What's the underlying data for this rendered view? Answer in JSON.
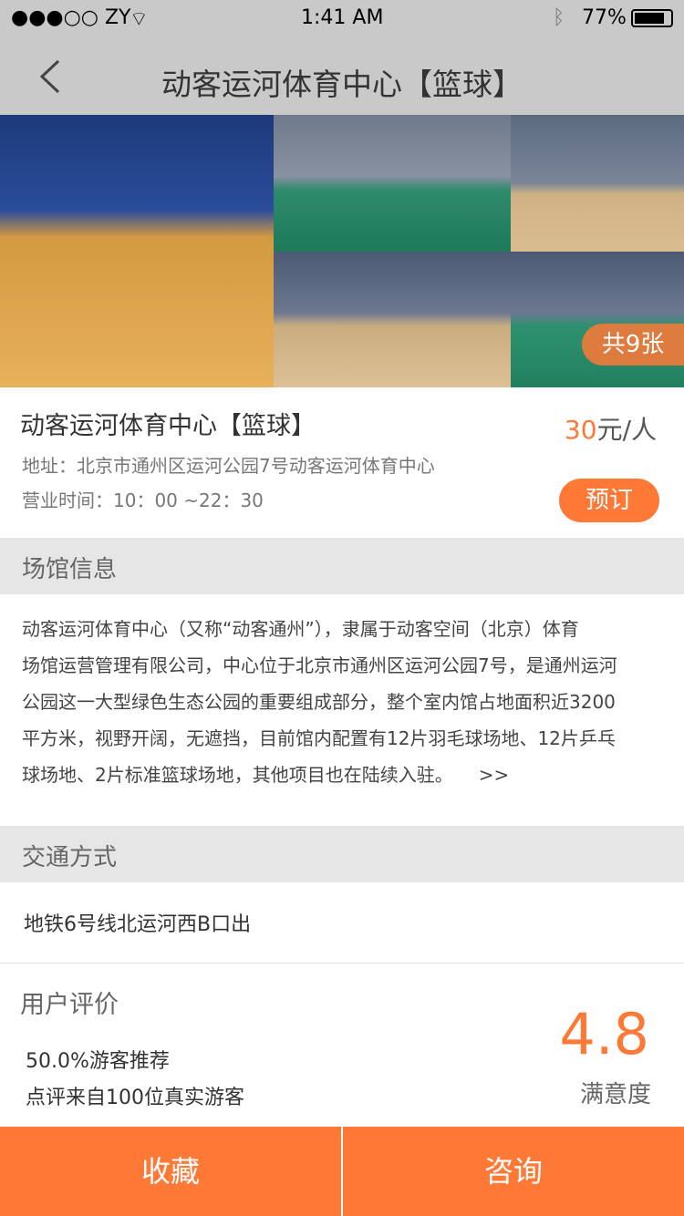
{
  "status_bar": {
    "carrier": "●●●○○ ZY",
    "time": "1:41 AM",
    "battery": "77%"
  },
  "nav": {
    "title": "动客运河体育中心【篮球】"
  },
  "photos": {
    "count_label": "共9张"
  },
  "venue": {
    "name": "动客运河体育中心【篮球】",
    "price_value": "30",
    "price_unit": "元/人",
    "address": "地址：北京市通州区运河公园7号动客运河体育中心",
    "hours": "营业时间：10：00  ~22：30",
    "book_label": "预订"
  },
  "info_section": {
    "title": "场馆信息",
    "lines": [
      "动客运河体育中心（又称“动客通州”），隶属于动客空间（北京）体育",
      "场馆运营管理有限公司，中心位于北京市通州区运河公园7号，是通州运河",
      "公园这一大型绿色生态公园的重要组成部分，整个室内馆占地面积近3200",
      "平方米，视野开阔，无遮挡，目前馆内配置有12片羽毛球场地、12片乒乓",
      "球场地、2片标准篮球场地，其他项目也在陆续入驻。"
    ],
    "more": ">>"
  },
  "transport": {
    "title": "交通方式",
    "text": "地铁6号线北运河西B口出"
  },
  "reviews": {
    "title": "用户评价",
    "recommend": "50.0%游客推荐",
    "source": "点评来自100位真实游客",
    "score": "4.8",
    "score_label": "满意度"
  },
  "bottom": {
    "favorite": "收藏",
    "consult": "咨询"
  },
  "colors": {
    "accent": "#fe7836"
  }
}
